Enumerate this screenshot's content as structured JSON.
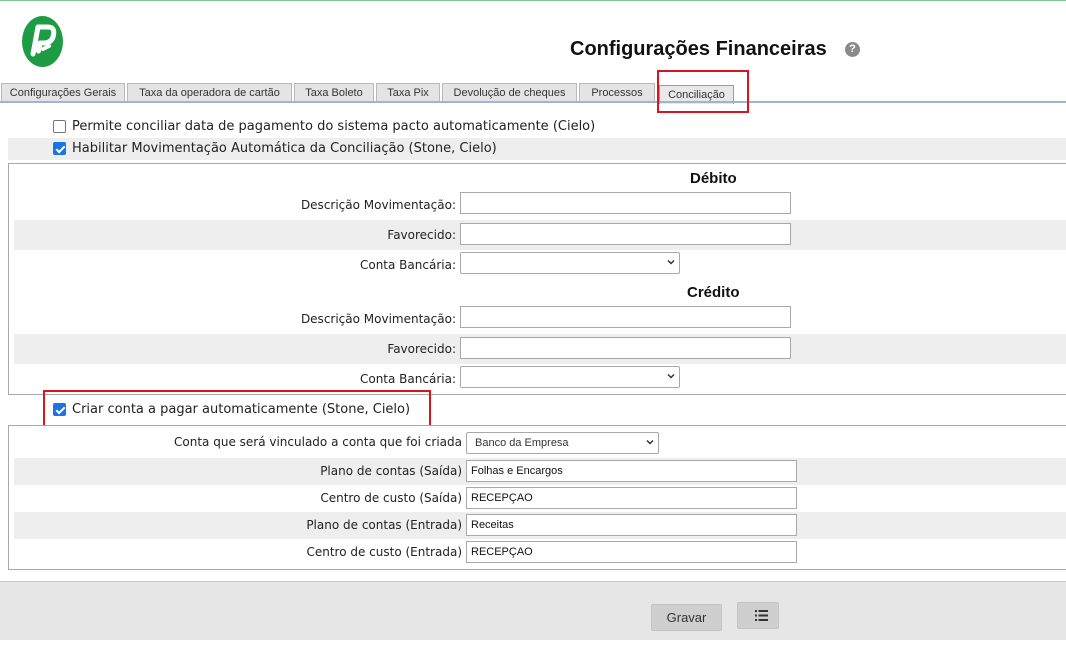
{
  "header": {
    "title": "Configurações Financeiras",
    "help_icon": "question-circle-icon",
    "logo": "pacto-logo",
    "brand_color": "#1e9b45"
  },
  "tabs": [
    {
      "label": "Configurações Gerais",
      "active": false
    },
    {
      "label": "Taxa da operadora de cartão",
      "active": false
    },
    {
      "label": "Taxa Boleto",
      "active": false
    },
    {
      "label": "Taxa Pix",
      "active": false
    },
    {
      "label": "Devolução de cheques",
      "active": false
    },
    {
      "label": "Processos",
      "active": false
    },
    {
      "label": "Conciliação",
      "active": true
    }
  ],
  "options": {
    "permite_conciliar": {
      "label": "Permite conciliar data de pagamento do sistema pacto automaticamente (Cielo)",
      "checked": false
    },
    "habilitar_movimentacao": {
      "label": "Habilitar Movimentação Automática da Conciliação (Stone, Cielo)",
      "checked": true
    },
    "criar_conta_pagar": {
      "label": "Criar conta a pagar automaticamente (Stone, Cielo)",
      "checked": true
    }
  },
  "debito": {
    "title": "Débito",
    "descricao_label": "Descrição Movimentação:",
    "descricao_value": "",
    "favorecido_label": "Favorecido:",
    "favorecido_value": "",
    "conta_label": "Conta Bancária:",
    "conta_value": ""
  },
  "credito": {
    "title": "Crédito",
    "descricao_label": "Descrição Movimentação:",
    "descricao_value": "",
    "favorecido_label": "Favorecido:",
    "favorecido_value": "",
    "conta_label": "Conta Bancária:",
    "conta_value": ""
  },
  "conta_pagar": {
    "vinculo_label": "Conta que será vinculado a conta que foi criada",
    "vinculo_value": "Banco da Empresa",
    "plano_saida_label": "Plano de contas (Saída)",
    "plano_saida_value": "Folhas e Encargos",
    "centro_saida_label": "Centro de custo (Saída)",
    "centro_saida_value": "RECEPÇAO",
    "plano_entrada_label": "Plano de contas (Entrada)",
    "plano_entrada_value": "Receitas",
    "centro_entrada_label": "Centro de custo (Entrada)",
    "centro_entrada_value": "RECEPÇAO"
  },
  "footer": {
    "save_label": "Gravar",
    "list_icon": "list-icon"
  },
  "colors": {
    "highlight": "#d7141f",
    "checkbox": "#1a73e8"
  }
}
